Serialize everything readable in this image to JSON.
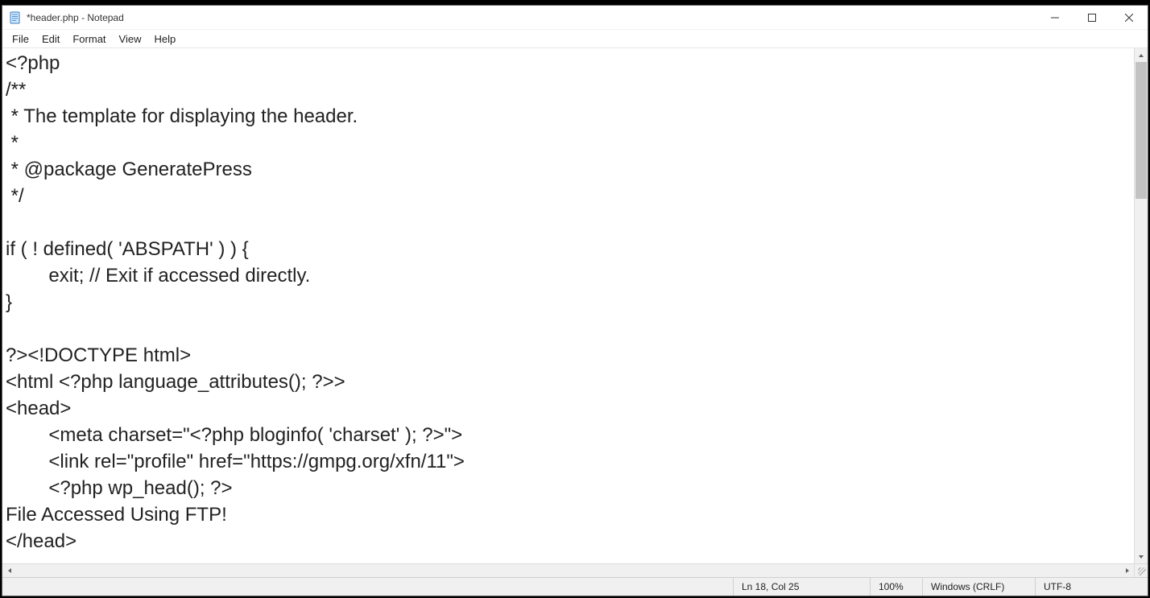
{
  "window": {
    "title": "*header.php - Notepad"
  },
  "menu": {
    "file": "File",
    "edit": "Edit",
    "format": "Format",
    "view": "View",
    "help": "Help"
  },
  "editor": {
    "content": "<?php\n/**\n * The template for displaying the header.\n *\n * @package GeneratePress\n */\n\nif ( ! defined( 'ABSPATH' ) ) {\n\texit; // Exit if accessed directly.\n}\n\n?><!DOCTYPE html>\n<html <?php language_attributes(); ?>>\n<head>\n\t<meta charset=\"<?php bloginfo( 'charset' ); ?>\">\n\t<link rel=\"profile\" href=\"https://gmpg.org/xfn/11\">\n\t<?php wp_head(); ?>\nFile Accessed Using FTP!\n</head>"
  },
  "status": {
    "position": "Ln 18, Col 25",
    "zoom": "100%",
    "eol": "Windows (CRLF)",
    "encoding": "UTF-8"
  }
}
